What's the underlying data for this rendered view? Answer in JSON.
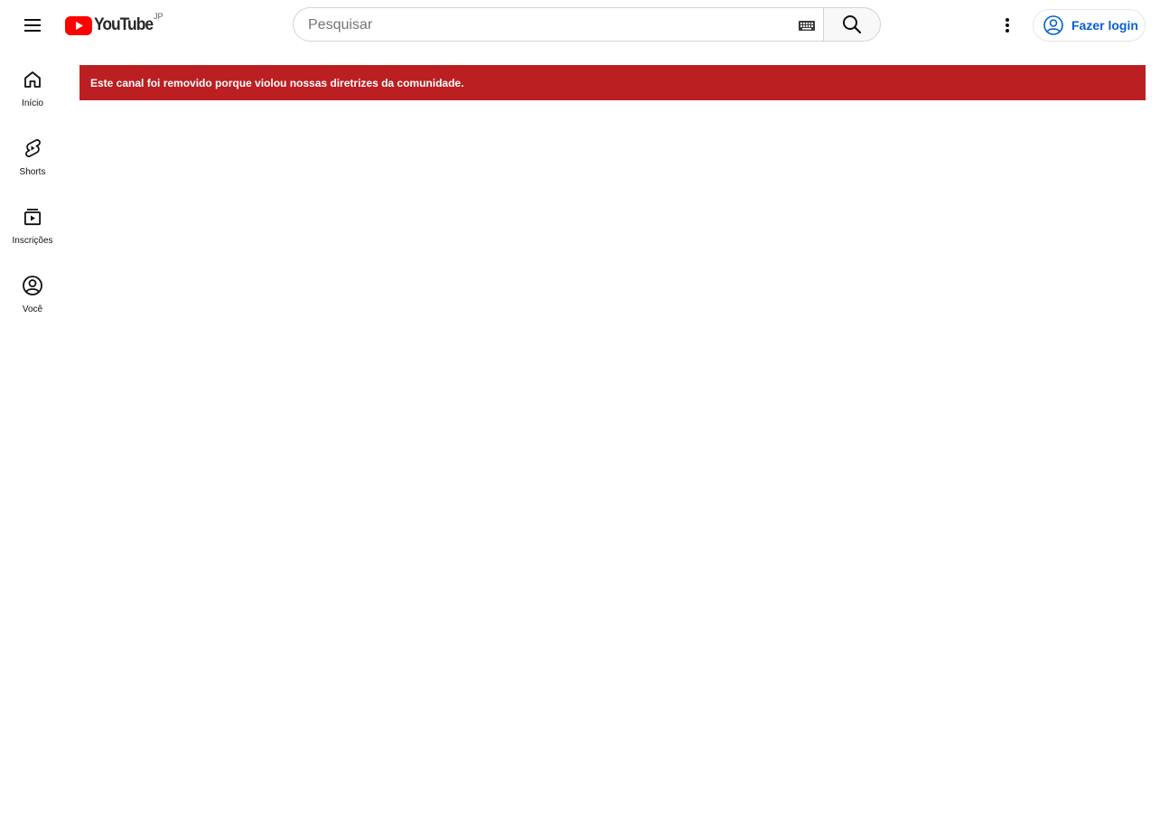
{
  "header": {
    "logo_text": "YouTube",
    "country_code": "JP",
    "search": {
      "placeholder": "Pesquisar",
      "value": ""
    },
    "signin_label": "Fazer login"
  },
  "sidebar": {
    "items": [
      {
        "label": "Início",
        "icon": "home-icon"
      },
      {
        "label": "Shorts",
        "icon": "shorts-icon"
      },
      {
        "label": "Inscrições",
        "icon": "subscriptions-icon"
      },
      {
        "label": "Você",
        "icon": "you-icon"
      }
    ]
  },
  "alert": {
    "message": "Este canal foi removido porque violou nossas diretrizes da comunidade.",
    "color": "#bb1f22"
  },
  "colors": {
    "brand_red": "#ff0000",
    "link_blue": "#065fd4"
  }
}
